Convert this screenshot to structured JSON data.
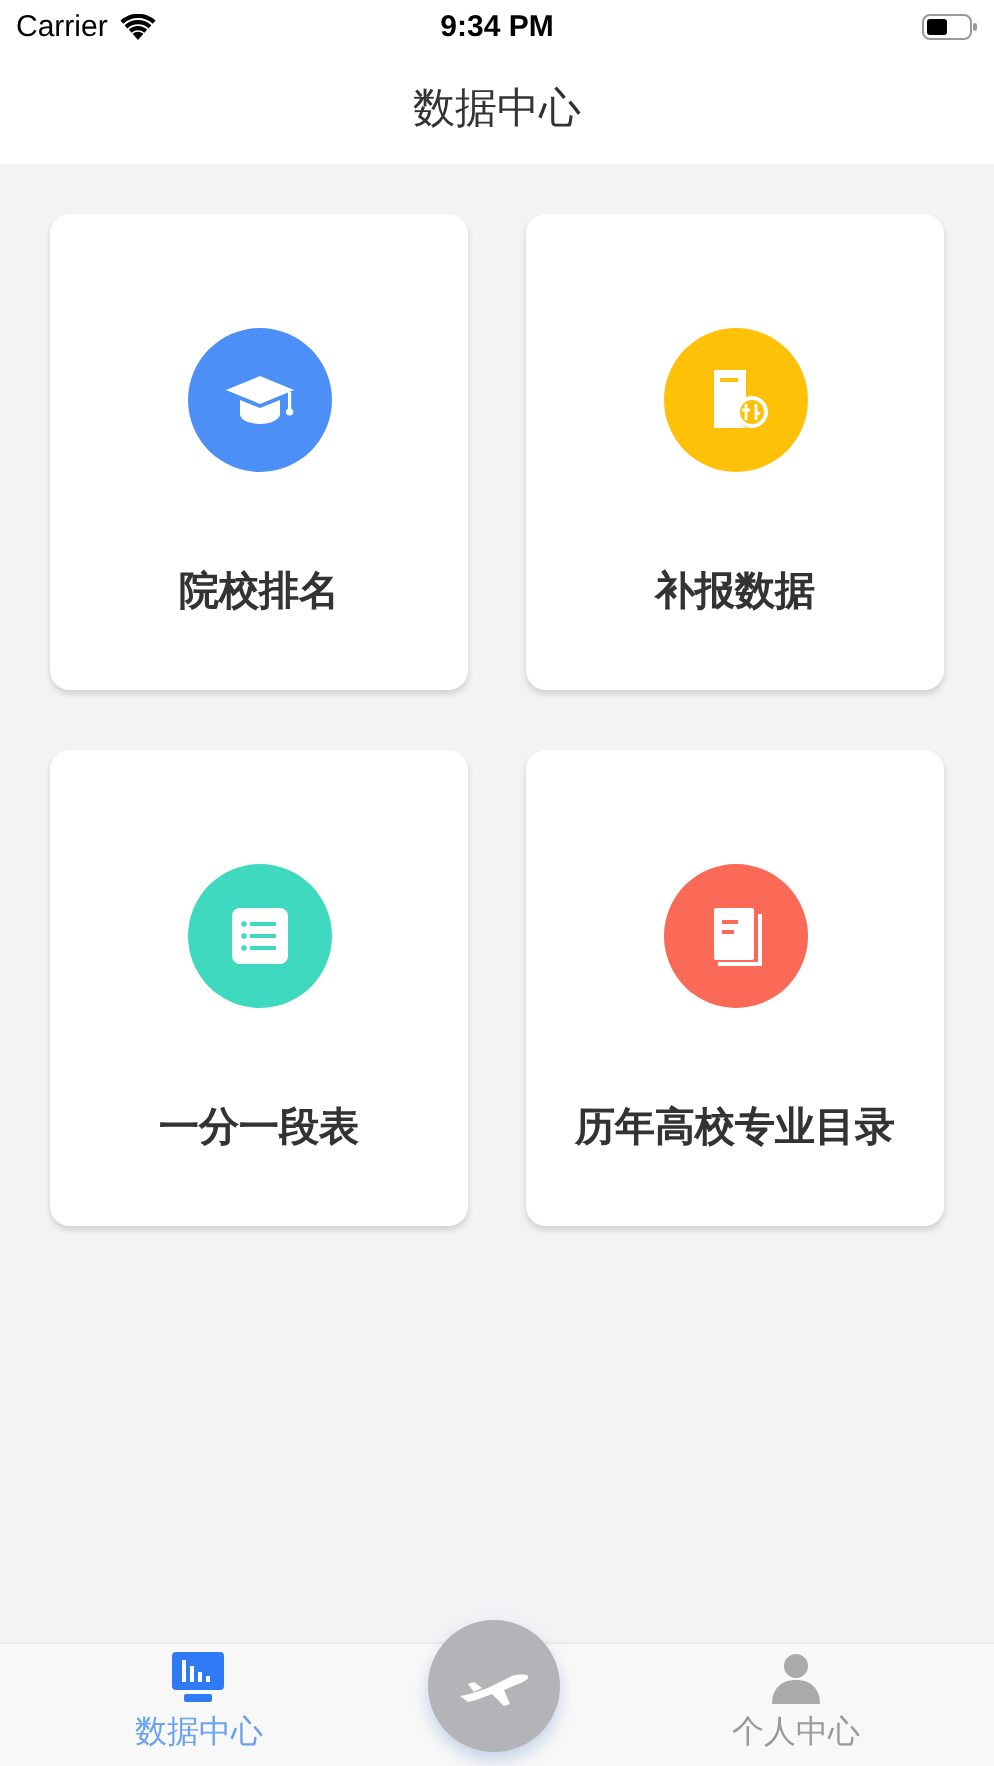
{
  "status_bar": {
    "carrier": "Carrier",
    "time": "9:34 PM"
  },
  "title": "数据中心",
  "cards": [
    {
      "kind": "cap",
      "label": "院校排名",
      "color": "#4c8ff7"
    },
    {
      "kind": "supplement",
      "label": "补报数据",
      "color": "#ffc107"
    },
    {
      "kind": "list",
      "label": "一分一段表",
      "color": "#3fd9c0"
    },
    {
      "kind": "book",
      "label": "历年高校专业目录",
      "color": "#fb6a57"
    }
  ],
  "tab_bar": {
    "tabs": [
      {
        "kind": "chart",
        "label": "数据中心",
        "selected": true
      },
      {
        "kind": "center"
      },
      {
        "kind": "person",
        "label": "个人中心",
        "selected": false
      }
    ]
  }
}
